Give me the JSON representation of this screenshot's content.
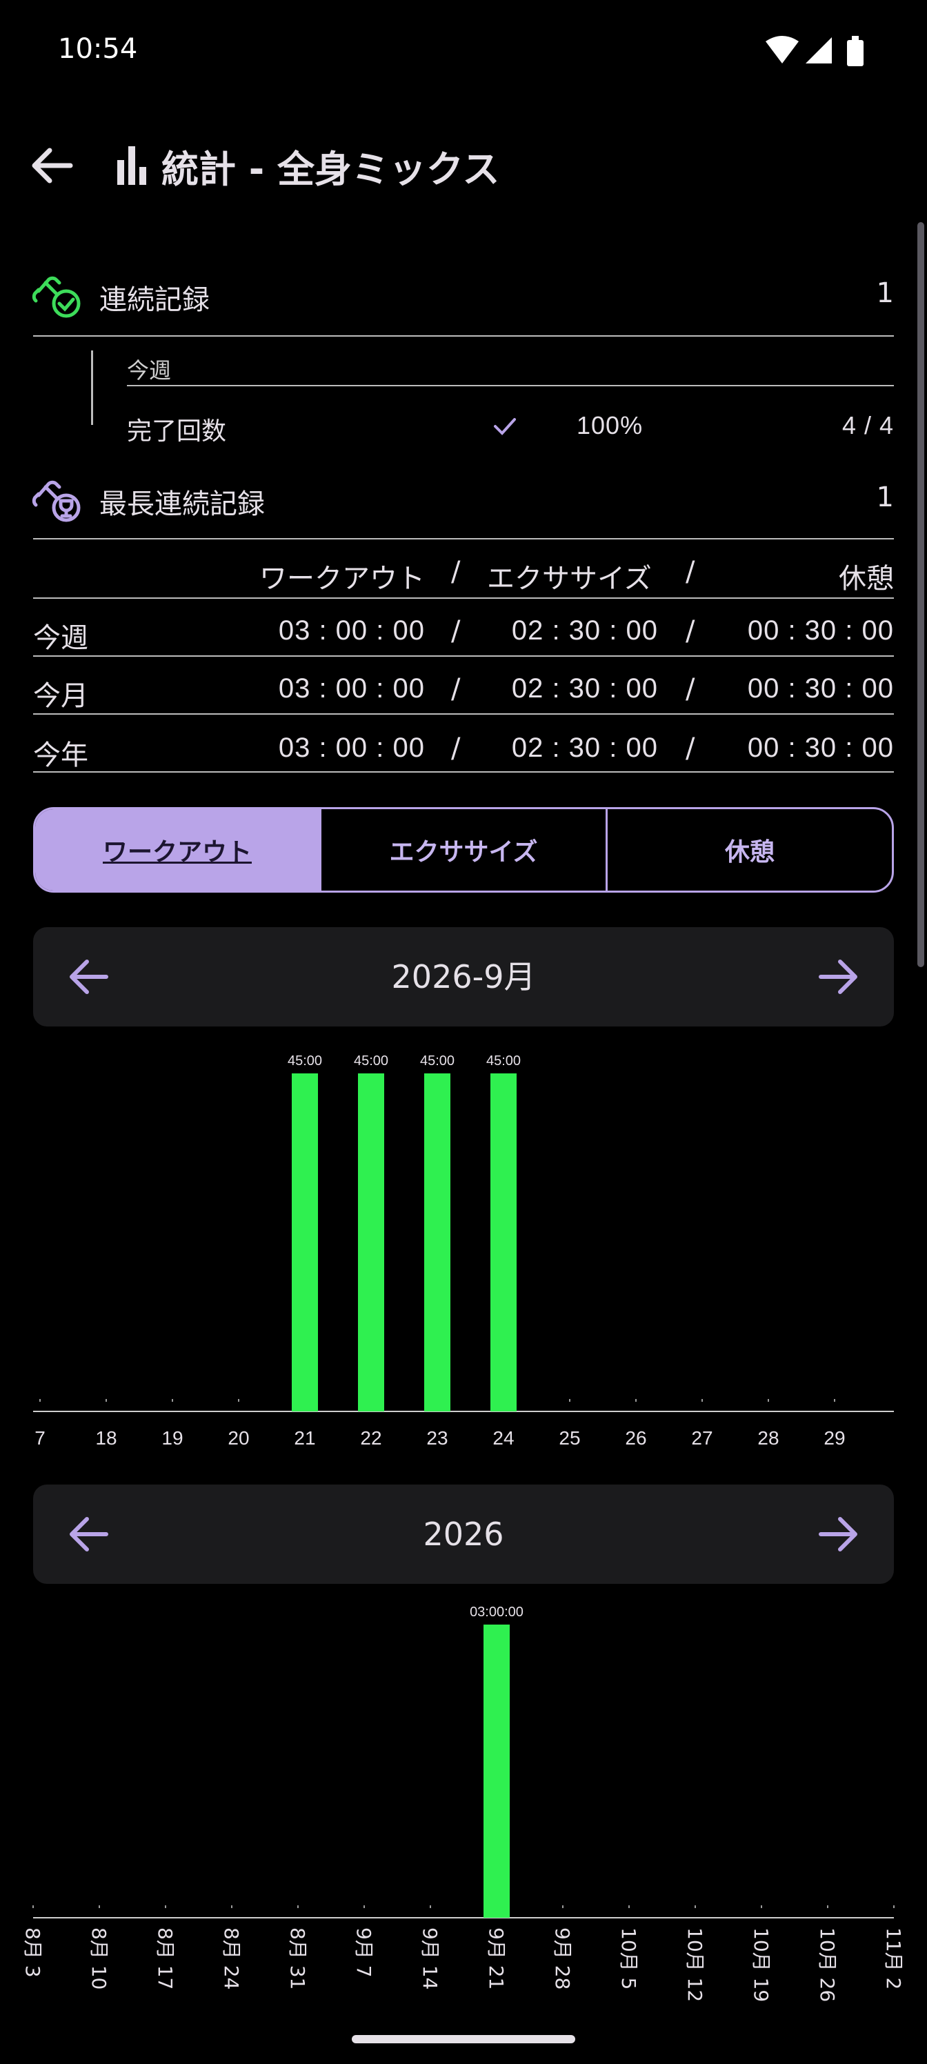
{
  "status_bar": {
    "time": "10:54"
  },
  "app_bar": {
    "title": "統計 - 全身ミックス"
  },
  "streak": {
    "label": "連続記録",
    "value": "1"
  },
  "week": {
    "header": "今週",
    "completion_label": "完了回数",
    "completion_percent": "100%",
    "completion_count": "4 / 4"
  },
  "longest_streak": {
    "label": "最長連続記録",
    "value": "1"
  },
  "totals_table": {
    "headers": [
      "ワークアウト",
      "/",
      "エクササイズ",
      "/",
      "休憩"
    ],
    "rows": [
      {
        "label": "今週",
        "workout": "03 : 00 : 00",
        "exercise": "02 : 30 : 00",
        "rest": "00 : 30 : 00"
      },
      {
        "label": "今月",
        "workout": "03 : 00 : 00",
        "exercise": "02 : 30 : 00",
        "rest": "00 : 30 : 00"
      },
      {
        "label": "今年",
        "workout": "03 : 00 : 00",
        "exercise": "02 : 30 : 00",
        "rest": "00 : 30 : 00"
      }
    ],
    "separator": "/"
  },
  "tabs": [
    {
      "label": "ワークアウト",
      "active": true
    },
    {
      "label": "エクササイズ",
      "active": false
    },
    {
      "label": "休憩",
      "active": false
    }
  ],
  "month_nav": {
    "label": "2026-9月"
  },
  "year_nav": {
    "label": "2026"
  },
  "colors": {
    "bar": "#2ff050",
    "accent": "#b9a4e8",
    "axis": "#cfcfcf"
  },
  "chart_data": [
    {
      "type": "bar",
      "title": "",
      "categories": [
        "7",
        "18",
        "19",
        "20",
        "21",
        "22",
        "23",
        "24",
        "25",
        "26",
        "27",
        "28",
        "29"
      ],
      "values": [
        0,
        0,
        0,
        0,
        45,
        45,
        45,
        45,
        0,
        0,
        0,
        0,
        0
      ],
      "value_labels": [
        "",
        "",
        "",
        "",
        "45:00",
        "45:00",
        "45:00",
        "45:00",
        "",
        "",
        "",
        "",
        ""
      ],
      "unit": "minutes",
      "ylim": [
        0,
        45
      ],
      "grid": false
    },
    {
      "type": "bar",
      "title": "",
      "categories": [
        "8月 3",
        "8月 10",
        "8月 17",
        "8月 24",
        "8月 31",
        "9月 7",
        "9月 14",
        "9月 21",
        "9月 28",
        "10月 5",
        "10月 12",
        "10月 19",
        "10月 26",
        "11月 2"
      ],
      "values": [
        0,
        0,
        0,
        0,
        0,
        0,
        0,
        180,
        0,
        0,
        0,
        0,
        0,
        0
      ],
      "value_labels": [
        "",
        "",
        "",
        "",
        "",
        "",
        "",
        "03:00:00",
        "",
        "",
        "",
        "",
        "",
        ""
      ],
      "unit": "minutes",
      "ylim": [
        0,
        180
      ],
      "grid": false
    }
  ]
}
